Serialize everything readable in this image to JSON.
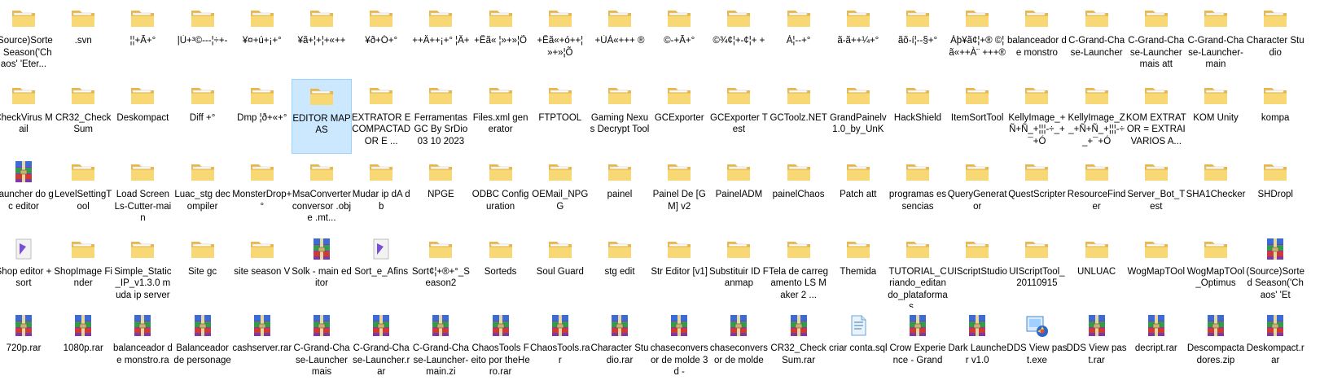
{
  "explorer": {
    "rows": [
      [
        {
          "label": "(Source)Sorted Season('Chaos' 'Eter...",
          "icon": "folder-icon"
        },
        {
          "label": ".svn",
          "icon": "folder-icon"
        },
        {
          "label": "¦¦+Ã+°",
          "icon": "folder-icon"
        },
        {
          "label": "|Ù+³©---¦÷+-",
          "icon": "folder-icon"
        },
        {
          "label": "¥¤+ú+¡+°",
          "icon": "folder-icon"
        },
        {
          "label": "¥ã+¦+¦+«++",
          "icon": "folder-icon"
        },
        {
          "label": "¥ð+Ó+°",
          "icon": "folder-icon"
        },
        {
          "label": "++Ä++¡+° ¦Ä+",
          "icon": "folder-icon"
        },
        {
          "label": "+Êã« ¦»+»¦Õ",
          "icon": "folder-icon"
        },
        {
          "label": "+Êã«+ó++¦ »+»¦Õ",
          "icon": "folder-icon"
        },
        {
          "label": "+ÙÀ«+++ ®",
          "icon": "folder-icon"
        },
        {
          "label": "©-+Ã+°",
          "icon": "folder-icon"
        },
        {
          "label": "©¾¢¦+-¢¦+ +",
          "icon": "folder-icon"
        },
        {
          "label": "À¦--+°",
          "icon": "folder-icon"
        },
        {
          "label": "ã-ã++¼+°",
          "icon": "folder-icon"
        },
        {
          "label": "ãõ-í¦--§+°",
          "icon": "folder-icon"
        },
        {
          "label": "Àþ¥ã¢¦+® ©¦ã«++À¨ +++®",
          "icon": "folder-icon"
        },
        {
          "label": "balanceador de monstro",
          "icon": "folder-icon"
        },
        {
          "label": "C-Grand-Chase-Launcher",
          "icon": "folder-icon"
        },
        {
          "label": "C-Grand-Chase-Launcher mais att",
          "icon": "folder-icon"
        },
        {
          "label": "C-Grand-Chase-Launcher-main",
          "icon": "folder-icon"
        },
        {
          "label": "Character Studio",
          "icon": "folder-icon"
        }
      ],
      [
        {
          "label": "CheckVirus Mail",
          "icon": "folder-icon"
        },
        {
          "label": "CR32_CheckSum",
          "icon": "folder-icon"
        },
        {
          "label": "Deskompact",
          "icon": "folder-icon"
        },
        {
          "label": "Diff +°",
          "icon": "folder-icon"
        },
        {
          "label": "Dmp ¦ð+«+°",
          "icon": "folder-icon"
        },
        {
          "label": "EDITOR MAPAS",
          "icon": "folder-icon",
          "selected": true
        },
        {
          "label": "EXTRATOR E COMPACTADOR E ...",
          "icon": "folder-icon"
        },
        {
          "label": "Ferramentas GC By SrDio 03 10 2023",
          "icon": "folder-icon"
        },
        {
          "label": "Files.xml generator",
          "icon": "folder-icon"
        },
        {
          "label": "FTPTOOL",
          "icon": "folder-icon"
        },
        {
          "label": "Gaming Nexus Decrypt Tool",
          "icon": "folder-icon"
        },
        {
          "label": "GCExporter",
          "icon": "folder-icon"
        },
        {
          "label": "GCExporter Test",
          "icon": "folder-icon"
        },
        {
          "label": "GCToolz.NET",
          "icon": "folder-icon"
        },
        {
          "label": "GrandPainelv1.0_by_UnK",
          "icon": "folder-icon"
        },
        {
          "label": "HackShield",
          "icon": "folder-icon"
        },
        {
          "label": "ItemSortTool",
          "icon": "folder-icon"
        },
        {
          "label": "KellyImage_+Ñ+Ñ_+¦¦¦-÷_+¯+Ó",
          "icon": "folder-icon"
        },
        {
          "label": "KellyImage_Z_+Ñ+Ñ_+¦¦¦-÷_+¯+Ó",
          "icon": "folder-icon"
        },
        {
          "label": "KOM EXTRATOR = EXTRAI VARIOS A...",
          "icon": "folder-icon"
        },
        {
          "label": "KOM Unity",
          "icon": "folder-icon"
        },
        {
          "label": "kompa",
          "icon": "folder-icon"
        }
      ],
      [
        {
          "label": "Launcher do gc editor",
          "icon": "rar-icon"
        },
        {
          "label": "LevelSettingTool",
          "icon": "folder-icon"
        },
        {
          "label": "Load Screen Ls-Cutter-main",
          "icon": "folder-icon"
        },
        {
          "label": "Luac_stg decompiler",
          "icon": "folder-icon"
        },
        {
          "label": "MonsterDrop+°",
          "icon": "folder-icon"
        },
        {
          "label": "MsaConverter conversor .obj e .mt...",
          "icon": "folder-icon"
        },
        {
          "label": "Mudar ip dA db",
          "icon": "folder-icon"
        },
        {
          "label": "NPGE",
          "icon": "folder-icon"
        },
        {
          "label": "ODBC Configuration",
          "icon": "folder-icon"
        },
        {
          "label": "OEMail_NPGG",
          "icon": "folder-icon"
        },
        {
          "label": "painel",
          "icon": "folder-icon"
        },
        {
          "label": "Painel De [GM] v2",
          "icon": "folder-icon"
        },
        {
          "label": "PainelADM",
          "icon": "folder-icon"
        },
        {
          "label": "painelChaos",
          "icon": "folder-icon"
        },
        {
          "label": "Patch att",
          "icon": "folder-icon"
        },
        {
          "label": "programas essencias",
          "icon": "folder-icon"
        },
        {
          "label": "QueryGenerator",
          "icon": "folder-icon"
        },
        {
          "label": "QuestScripter",
          "icon": "folder-icon"
        },
        {
          "label": "ResourceFinder",
          "icon": "folder-icon"
        },
        {
          "label": "Server_Bot_Test",
          "icon": "folder-icon"
        },
        {
          "label": "SHA1Checker",
          "icon": "folder-icon"
        },
        {
          "label": "SHDropl",
          "icon": "folder-icon"
        }
      ],
      [
        {
          "label": "Shop editor + sort",
          "icon": "app-icon"
        },
        {
          "label": "ShopImage Finder",
          "icon": "folder-icon"
        },
        {
          "label": "Simple_Static_IP_v1.3.0 muda ip server",
          "icon": "folder-icon"
        },
        {
          "label": "Site gc",
          "icon": "folder-icon"
        },
        {
          "label": "site season V",
          "icon": "folder-icon"
        },
        {
          "label": "Solk - main editor",
          "icon": "rar-icon"
        },
        {
          "label": "Sort_e_Afins",
          "icon": "app-icon"
        },
        {
          "label": "Sort¢¦+®+°_Season2",
          "icon": "folder-icon"
        },
        {
          "label": "Sorteds",
          "icon": "folder-icon"
        },
        {
          "label": "Soul Guard",
          "icon": "folder-icon"
        },
        {
          "label": "stg edit",
          "icon": "folder-icon"
        },
        {
          "label": "Str Editor [v1]",
          "icon": "folder-icon"
        },
        {
          "label": "Substituir ID Fanmap",
          "icon": "folder-icon"
        },
        {
          "label": "Tela de carregamento LS Maker 2 ...",
          "icon": "folder-icon"
        },
        {
          "label": "Themida",
          "icon": "folder-icon"
        },
        {
          "label": "TUTORIAL_Criando_editando_plataformas_...",
          "icon": "folder-icon"
        },
        {
          "label": "UIScriptStudio",
          "icon": "folder-icon"
        },
        {
          "label": "UIScriptTool_20110915",
          "icon": "folder-icon"
        },
        {
          "label": "UNLUAC",
          "icon": "folder-icon"
        },
        {
          "label": "WogMapTOol",
          "icon": "folder-icon"
        },
        {
          "label": "WogMapTOol_Optimus",
          "icon": "folder-icon"
        },
        {
          "label": "(Source)Sorted Season('Chaos' 'Et",
          "icon": "rar-icon"
        }
      ],
      [
        {
          "label": "720p.rar",
          "icon": "rar-icon"
        },
        {
          "label": "1080p.rar",
          "icon": "rar-icon"
        },
        {
          "label": "balanceador de monstro.ra",
          "icon": "rar-icon"
        },
        {
          "label": "Balanceador de personage",
          "icon": "rar-icon"
        },
        {
          "label": "cashserver.rar",
          "icon": "rar-icon"
        },
        {
          "label": "C-Grand-Chase-Launcher mais",
          "icon": "rar-icon"
        },
        {
          "label": "C-Grand-Chase-Launcher.rar",
          "icon": "rar-icon"
        },
        {
          "label": "C-Grand-Chase-Launcher-main.zi",
          "icon": "rar-icon"
        },
        {
          "label": "ChaosTools Feito por theHero.rar",
          "icon": "rar-icon"
        },
        {
          "label": "ChaosTools.rar",
          "icon": "rar-icon"
        },
        {
          "label": "Character Studio.rar",
          "icon": "rar-icon"
        },
        {
          "label": "chaseconversor de molde 3d -",
          "icon": "rar-icon"
        },
        {
          "label": "chaseconversor de molde",
          "icon": "rar-icon"
        },
        {
          "label": "CR32_CheckSum.rar",
          "icon": "rar-icon"
        },
        {
          "label": "criar conta.sql",
          "icon": "sql-icon"
        },
        {
          "label": "Crow Experience - Grand",
          "icon": "rar-icon"
        },
        {
          "label": "Dark Launcher v1.0",
          "icon": "rar-icon"
        },
        {
          "label": "DDS View past.exe",
          "icon": "exe-icon"
        },
        {
          "label": "DDS View past.rar",
          "icon": "rar-icon"
        },
        {
          "label": "decript.rar",
          "icon": "rar-icon"
        },
        {
          "label": "Descompactadores.zip",
          "icon": "rar-icon"
        },
        {
          "label": "Deskompact.rar",
          "icon": "rar-icon"
        }
      ]
    ]
  }
}
